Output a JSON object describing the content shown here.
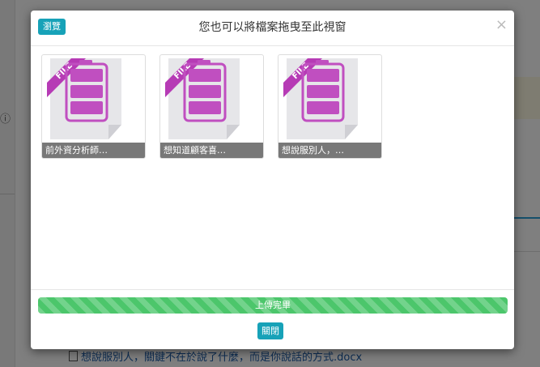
{
  "background": {
    "info_icon": "ⓘ",
    "file_row_text": "想說服別人，關鍵不在於說了什麼，而是你說話的方式.docx"
  },
  "modal": {
    "browse_label": "瀏覽",
    "title": "您也可以將檔案拖曳至此視窗",
    "close_symbol": "×",
    "files": [
      {
        "name": "前外資分析師…",
        "badge": "FILE"
      },
      {
        "name": "想知道顧客喜…",
        "badge": "FILE"
      },
      {
        "name": "想說服別人，…",
        "badge": "FILE"
      }
    ],
    "progress": {
      "label": "上傳完畢",
      "percent": 100
    },
    "close_button_label": "關閉"
  },
  "colors": {
    "accent": "#17a2b8",
    "progress": "#4cc66b",
    "file_icon": "#c04fc0"
  }
}
